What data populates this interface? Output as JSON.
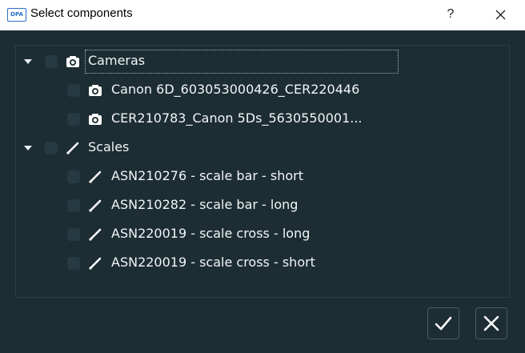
{
  "window": {
    "app_logo_text": "DPA",
    "title": "Select components",
    "help_label": "?"
  },
  "tree": [
    {
      "type": "group",
      "label": "Cameras",
      "icon": "camera-icon",
      "expanded": true,
      "checked": false,
      "focused": true
    },
    {
      "type": "item",
      "label": "Canon 6D_603053000426_CER220446",
      "icon": "camera-icon",
      "checked": false
    },
    {
      "type": "item",
      "label": "CER210783_Canon 5Ds_5630550001...",
      "icon": "camera-icon",
      "checked": false
    },
    {
      "type": "group",
      "label": "Scales",
      "icon": "scale-bar-icon",
      "expanded": true,
      "checked": false
    },
    {
      "type": "item",
      "label": "ASN210276 - scale bar - short",
      "icon": "scale-bar-icon",
      "checked": false
    },
    {
      "type": "item",
      "label": "ASN210282 - scale bar - long",
      "icon": "scale-bar-icon",
      "checked": false
    },
    {
      "type": "item",
      "label": "ASN220019 - scale cross - long",
      "icon": "scale-bar-icon",
      "checked": false
    },
    {
      "type": "item",
      "label": "ASN220019 - scale cross - short",
      "icon": "scale-bar-icon",
      "checked": false
    }
  ],
  "buttons": {
    "confirm_icon": "checkmark-icon",
    "cancel_icon": "close-icon"
  },
  "colors": {
    "background": "#1c2d33",
    "text": "#f2f5f6",
    "checkbox": "#263a41"
  }
}
